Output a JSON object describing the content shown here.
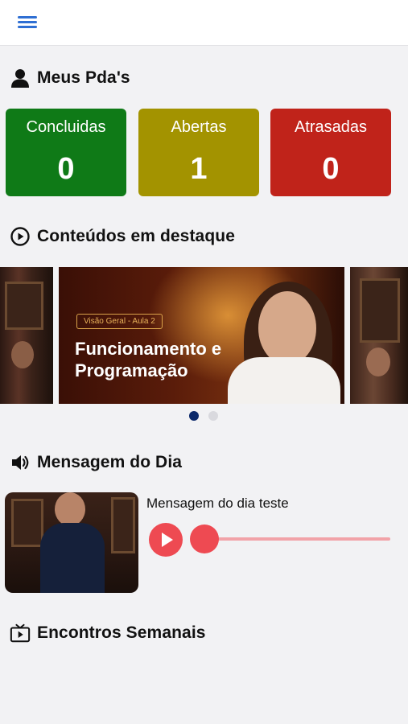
{
  "header": {
    "menu_icon": "hamburger-menu-icon",
    "accent": "#2f6fd3"
  },
  "pdas": {
    "title": "Meus Pda's",
    "icon": "user-icon",
    "cards": [
      {
        "label": "Concluidas",
        "count": "0",
        "color": "#0f7a17"
      },
      {
        "label": "Abertas",
        "count": "1",
        "color": "#a39300"
      },
      {
        "label": "Atrasadas",
        "count": "0",
        "color": "#c0231a"
      }
    ]
  },
  "featured": {
    "title": "Conteúdos em destaque",
    "icon": "play-circle-icon",
    "slide": {
      "tag": "Visão Geral - Aula 2",
      "headline": "Funcionamento e Programação"
    },
    "dots": {
      "active_color": "#0d2a6b",
      "inactive_color": "#d9d9de",
      "count": 2,
      "active_index": 0
    }
  },
  "message": {
    "title": "Mensagem do Dia",
    "icon": "speaker-icon",
    "item_title": "Mensagem do dia teste",
    "player": {
      "progress": 0,
      "color": "#ee4a52"
    }
  },
  "weekly": {
    "title": "Encontros Semanais",
    "icon": "tv-play-icon"
  }
}
